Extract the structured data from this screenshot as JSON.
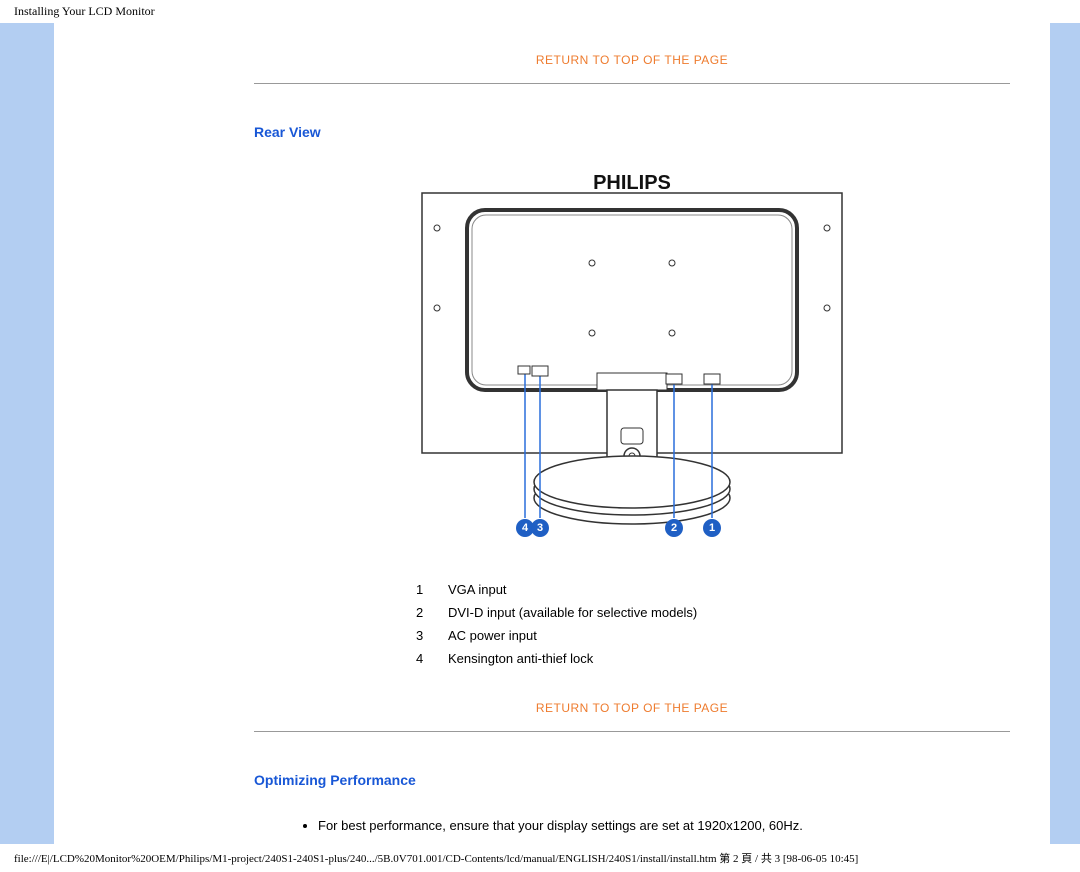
{
  "header": {
    "title": "Installing Your LCD Monitor"
  },
  "links": {
    "return_top": "RETURN TO TOP OF THE PAGE"
  },
  "sections": {
    "rear_view": "Rear View",
    "optimizing": "Optimizing Performance"
  },
  "brand": "PHILIPS",
  "rear_items": [
    {
      "num": "1",
      "label": "VGA input"
    },
    {
      "num": "2",
      "label": "DVI-D input (available for selective models)"
    },
    {
      "num": "3",
      "label": "AC power input"
    },
    {
      "num": "4",
      "label": "Kensington anti-thief lock"
    }
  ],
  "badges": [
    "4",
    "3",
    "2",
    "1"
  ],
  "optimizing_bullets": [
    "For best performance, ensure that your display settings are set at 1920x1200, 60Hz."
  ],
  "footer": {
    "path": "file:///E|/LCD%20Monitor%20OEM/Philips/M1-project/240S1-240S1-plus/240.../5B.0V701.001/CD-Contents/lcd/manual/ENGLISH/240S1/install/install.htm 第 2 頁 / 共 3  [98-06-05 10:45]"
  }
}
